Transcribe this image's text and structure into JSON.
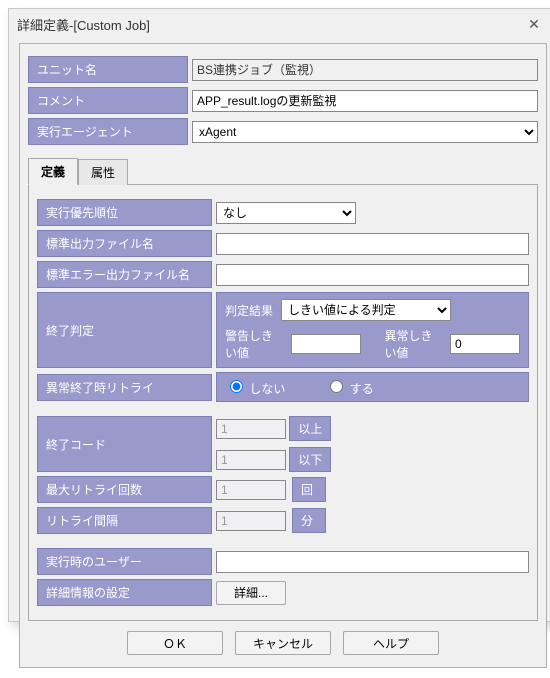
{
  "window": {
    "title": "詳細定義-[Custom Job]"
  },
  "header": {
    "unit_name_label": "ユニット名",
    "unit_name_value": "BS連携ジョブ（監視）",
    "comment_label": "コメント",
    "comment_value": "APP_result.logの更新監視",
    "agent_label": "実行エージェント",
    "agent_value": "xAgent"
  },
  "tabs": {
    "def": "定義",
    "attr": "属性"
  },
  "def": {
    "priority_label": "実行優先順位",
    "priority_value": "なし",
    "stdout_label": "標準出力ファイル名",
    "stdout_value": "",
    "stderr_label": "標準エラー出力ファイル名",
    "stderr_value": "",
    "end_judgment_label": "終了判定",
    "judgment_result_label": "判定結果",
    "judgment_result_value": "しきい値による判定",
    "warn_threshold_label": "警告しきい値",
    "warn_threshold_value": "",
    "abend_threshold_label": "異常しきい値",
    "abend_threshold_value": "0",
    "abend_retry_label": "異常終了時リトライ",
    "retry_no": "しない",
    "retry_yes": "する",
    "end_code_label": "終了コード",
    "end_code_v1": "1",
    "end_code_u1": "以上",
    "end_code_v2": "1",
    "end_code_u2": "以下",
    "max_retry_label": "最大リトライ回数",
    "max_retry_value": "1",
    "max_retry_unit": "回",
    "retry_interval_label": "リトライ間隔",
    "retry_interval_value": "1",
    "retry_interval_unit": "分",
    "run_user_label": "実行時のユーザー",
    "run_user_value": "",
    "detail_info_label": "詳細情報の設定",
    "detail_button": "詳細..."
  },
  "footer": {
    "ok": "ＯＫ",
    "cancel": "キャンセル",
    "help": "ヘルプ"
  }
}
